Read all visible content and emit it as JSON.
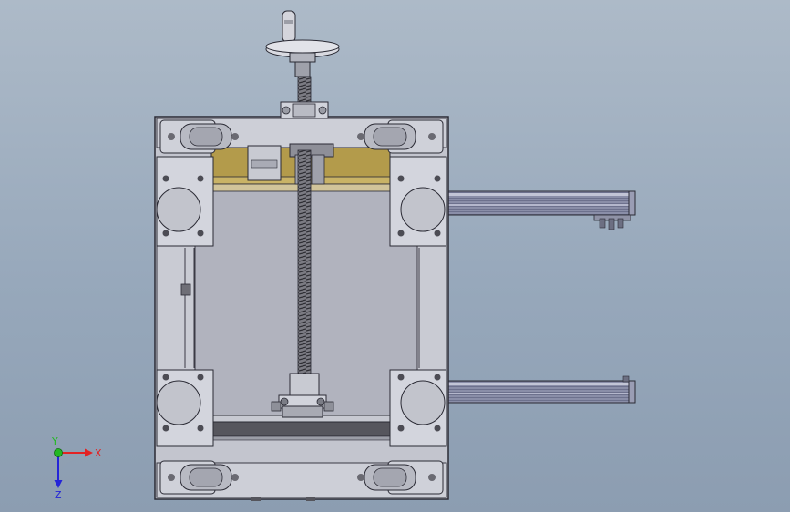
{
  "triad": {
    "x_label": "X",
    "y_label": "Y",
    "z_label": "Z",
    "colors": {
      "x": "#e32222",
      "y": "#22b822",
      "z": "#2424d8"
    }
  },
  "model": {
    "colors": {
      "frame_fill": "#c4c6cf",
      "frame_inner": "#b4b6c1",
      "frame_edge": "#2a2a34",
      "plate_fill": "#d3d5dd",
      "brass": "#b59d4d",
      "brass_dark": "#8d7934",
      "rail_fill": "#8589a4",
      "rail_light": "#b4b7cc",
      "crossbar": "#55555c",
      "wheel": "#b9bbc4",
      "screw": "#6a6a72"
    }
  }
}
